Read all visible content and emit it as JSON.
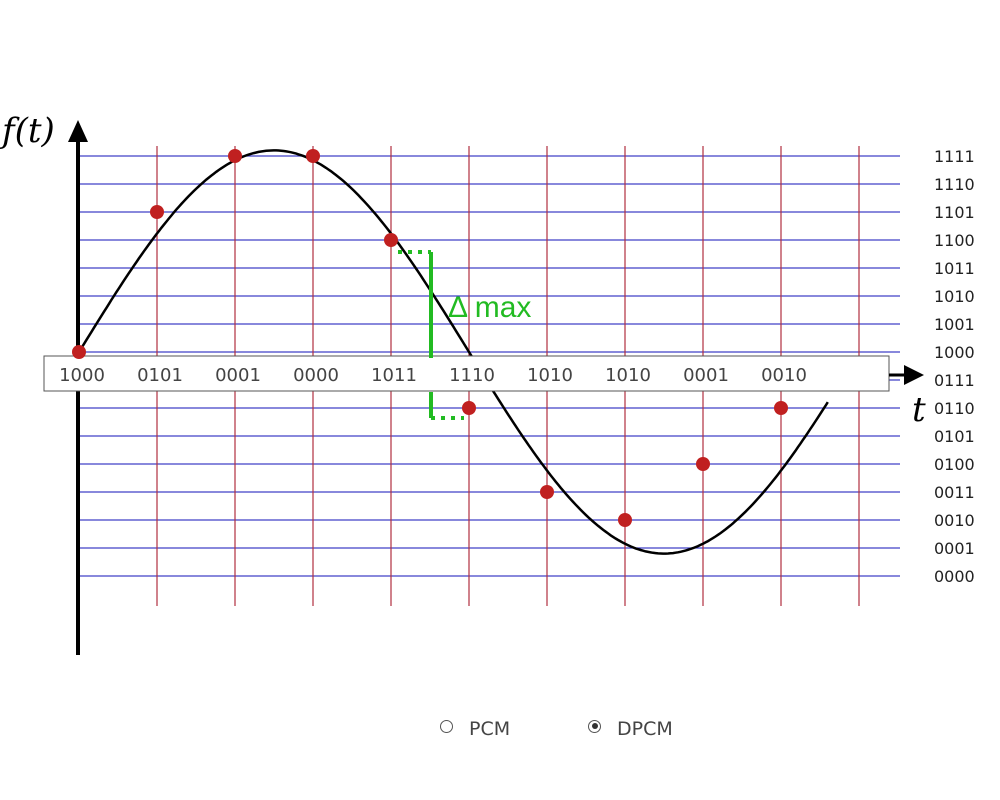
{
  "axes": {
    "y_label": "f(t)",
    "x_label": "t"
  },
  "levels": [
    "0000",
    "0001",
    "0010",
    "0011",
    "0100",
    "0101",
    "0110",
    "0111",
    "1000",
    "1001",
    "1010",
    "1011",
    "1100",
    "1101",
    "1110",
    "1111"
  ],
  "codes": [
    "1000",
    "0101",
    "0001",
    "0000",
    "1011",
    "1110",
    "1010",
    "1010",
    "0001",
    "0010"
  ],
  "delta_label": "Δ max",
  "colors": {
    "level_lines": "#4040c8",
    "time_lines": "#b03040",
    "curve": "#000000",
    "samples": "#c02020",
    "delta": "#22bb22"
  },
  "chart_data": {
    "type": "scatter",
    "series": [
      {
        "x": [
          0,
          1,
          2,
          3,
          4,
          5,
          6,
          7,
          8,
          9
        ],
        "y": [
          8,
          13,
          15,
          15,
          12,
          6,
          3,
          2,
          4,
          6
        ]
      }
    ],
    "ylim": [
      0,
      15
    ],
    "xlim": [
      0,
      10
    ],
    "curve": "sine"
  },
  "modes": {
    "pcm": {
      "label": "PCM",
      "selected": false
    },
    "dpcm": {
      "label": "DPCM",
      "selected": true
    }
  }
}
